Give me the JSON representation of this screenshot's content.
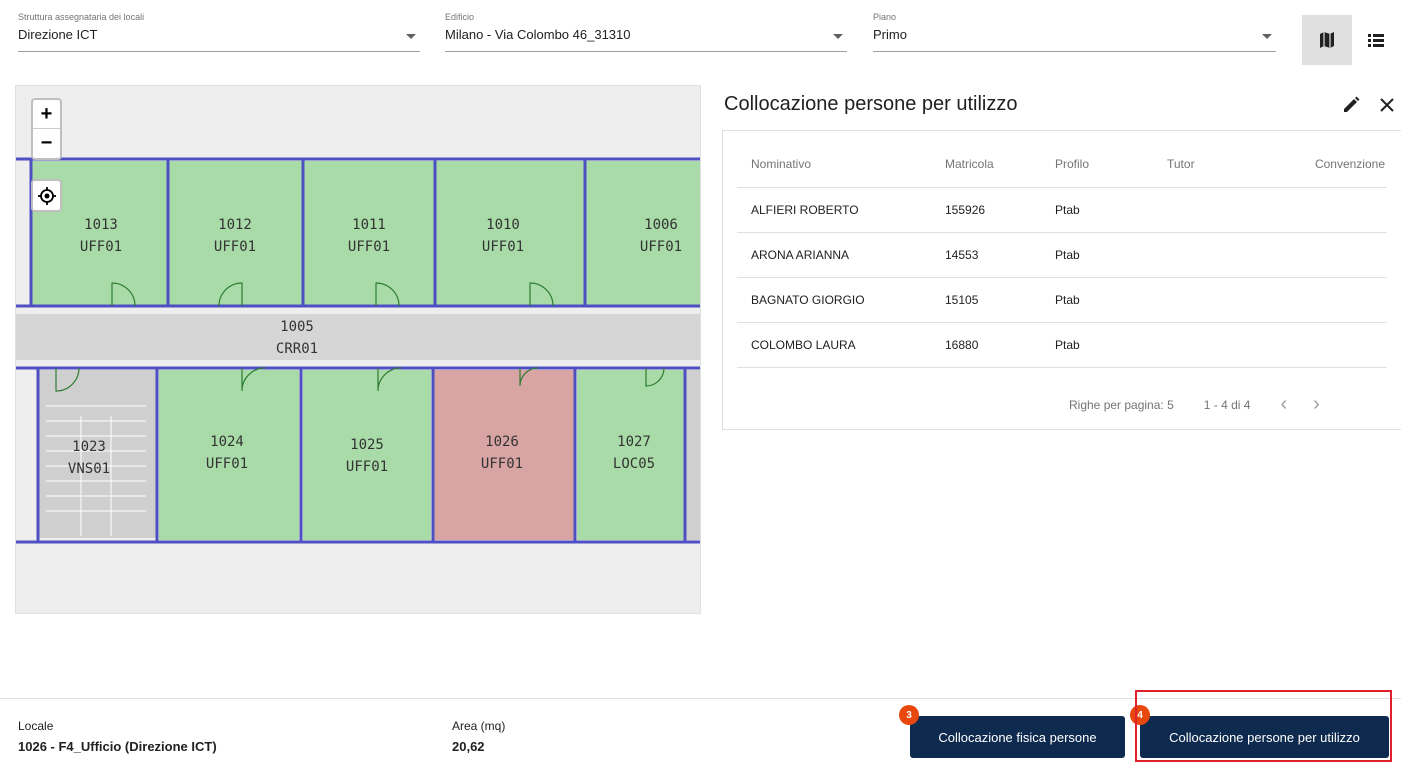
{
  "filters": {
    "struttura": {
      "label": "Struttura assegnataria dei locali",
      "value": "Direzione ICT"
    },
    "edificio": {
      "label": "Edificio",
      "value": "Milano - Via Colombo 46_31310"
    },
    "piano": {
      "label": "Piano",
      "value": "Primo"
    }
  },
  "view_toggle": {
    "map_icon": "map-icon",
    "list_icon": "list-icon",
    "selected": "map"
  },
  "map": {
    "controls": {
      "zoom_in": "+",
      "zoom_out": "−",
      "locate_icon": "locate-icon"
    },
    "rooms": [
      {
        "id": "1013",
        "type": "UFF01",
        "state": "assigned"
      },
      {
        "id": "1012",
        "type": "UFF01",
        "state": "assigned"
      },
      {
        "id": "1011",
        "type": "UFF01",
        "state": "assigned"
      },
      {
        "id": "1010",
        "type": "UFF01",
        "state": "assigned"
      },
      {
        "id": "1006",
        "type": "UFF01",
        "state": "assigned"
      },
      {
        "id": "1005",
        "type": "CRR01",
        "state": "corridor"
      },
      {
        "id": "1023",
        "type": "VNS01",
        "state": "stairs"
      },
      {
        "id": "1024",
        "type": "UFF01",
        "state": "assigned"
      },
      {
        "id": "1025",
        "type": "UFF01",
        "state": "assigned"
      },
      {
        "id": "1026",
        "type": "UFF01",
        "state": "selected"
      },
      {
        "id": "1027",
        "type": "LOC05",
        "state": "assigned"
      }
    ],
    "colors": {
      "assigned": "#a8dba8",
      "selected": "#d8a4a4",
      "corridor": "#d6d6d6",
      "wall": "#4f4fc4"
    }
  },
  "panel": {
    "title": "Collocazione persone per utilizzo",
    "edit_icon": "pencil-icon",
    "close_icon": "close-icon",
    "columns": [
      "Nominativo",
      "Matricola",
      "Profilo",
      "Tutor",
      "Convenzione"
    ],
    "rows": [
      [
        "ALFIERI ROBERTO",
        "155926",
        "Ptab",
        "",
        ""
      ],
      [
        "ARONA ARIANNA",
        "14553",
        "Ptab",
        "",
        ""
      ],
      [
        "BAGNATO GIORGIO",
        "15105",
        "Ptab",
        "",
        ""
      ],
      [
        "COLOMBO LAURA",
        "16880",
        "Ptab",
        "",
        ""
      ]
    ],
    "pager": {
      "rows_per_page": "Righe per pagina: 5",
      "range": "1 - 4 di 4",
      "prev": "‹",
      "next": "›"
    }
  },
  "footer": {
    "locale_label": "Locale",
    "locale_value": "1026 - F4_Ufficio (Direzione ICT)",
    "area_label": "Area (mq)",
    "area_value": "20,62",
    "btn_fisica": "Collocazione fisica persone",
    "btn_utilizzo": "Collocazione persone per utilizzo",
    "badge_fisica": "3",
    "badge_utilizzo": "4"
  }
}
